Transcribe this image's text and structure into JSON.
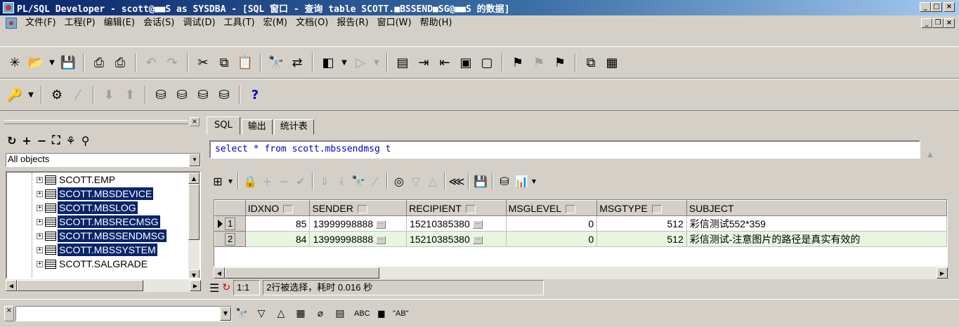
{
  "window": {
    "title": "PL/SQL Developer - scott@■■S as SYSDBA - [SQL 窗口 - 查询 table SCOTT.■BSSEND■SG@■■S 的数据]"
  },
  "menu": [
    {
      "label": "文件(F)"
    },
    {
      "label": "工程(P)"
    },
    {
      "label": "编辑(E)"
    },
    {
      "label": "会话(S)"
    },
    {
      "label": "调试(D)"
    },
    {
      "label": "工具(T)"
    },
    {
      "label": "宏(M)"
    },
    {
      "label": "文档(O)"
    },
    {
      "label": "报告(R)"
    },
    {
      "label": "窗口(W)"
    },
    {
      "label": "帮助(H)"
    }
  ],
  "object_browser": {
    "filter_value": "All objects",
    "tree_items": [
      {
        "label": "SCOTT.EMP",
        "selected": false
      },
      {
        "label": "SCOTT.MBSDEVICE",
        "selected": true
      },
      {
        "label": "SCOTT.MBSLOG",
        "selected": true
      },
      {
        "label": "SCOTT.MBSRECMSG",
        "selected": true
      },
      {
        "label": "SCOTT.MBSSENDMSG",
        "selected": true
      },
      {
        "label": "SCOTT.MBSSYSTEM",
        "selected": true
      },
      {
        "label": "SCOTT.SALGRADE",
        "selected": false
      }
    ]
  },
  "sql_window": {
    "tabs": [
      "SQL",
      "输出",
      "统计表"
    ],
    "sql_text": "select * from scott.mbssendmsg t",
    "grid": {
      "columns": [
        "IDXNO",
        "SENDER",
        "RECIPIENT",
        "MSGLEVEL",
        "MSGTYPE",
        "SUBJECT"
      ],
      "rows": [
        {
          "num": "1",
          "IDXNO": "85",
          "SENDER": "13999998888",
          "RECIPIENT": "15210385380",
          "MSGLEVEL": "0",
          "MSGTYPE": "512",
          "SUBJECT": "彩信测试552*359"
        },
        {
          "num": "2",
          "IDXNO": "84",
          "SENDER": "13999998888",
          "RECIPIENT": "15210385380",
          "MSGLEVEL": "0",
          "MSGTYPE": "512",
          "SUBJECT": "彩信测试-注意图片的路径是真实有效的"
        }
      ]
    },
    "status": {
      "position": "1:1",
      "message": "2行被选择，耗时 0.016 秒"
    }
  },
  "find_bar": {
    "search_value": "",
    "abc_label": "ABC",
    "quote_label": "\"AB\""
  }
}
